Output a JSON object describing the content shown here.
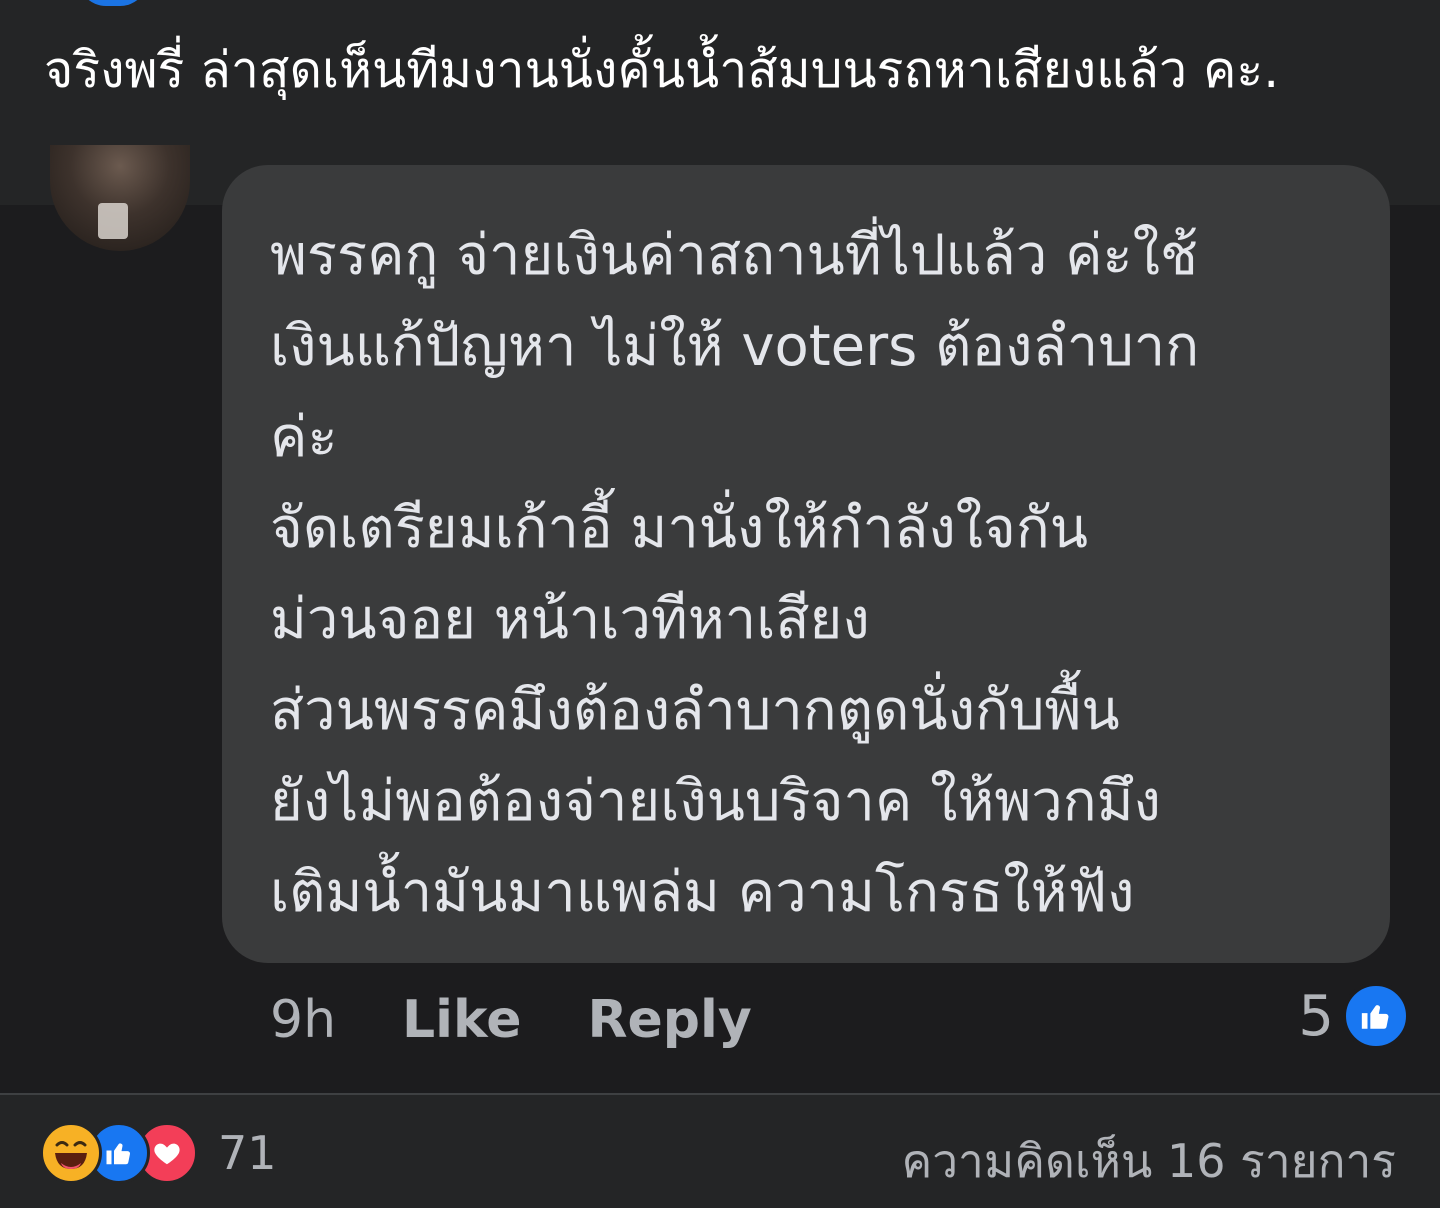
{
  "post": {
    "caption": "จริงพรี่ ล่าสุดเห็นทีมงานนั่งคั้นน้ำส้มบนรถหาเสียงแล้ว คะ."
  },
  "comment": {
    "lines": [
      "พรรคกู จ่ายเงินค่าสถานที่ไปแล้ว ค่ะใช้",
      "เงินแก้ปัญหา ไม่ให้ voters ต้องลำบาก",
      "ค่ะ",
      "จัดเตรียมเก้าอี้ มานั่งให้กำลังใจกัน",
      "ม่วนจอย หน้าเวทีหาเสียง",
      "ส่วนพรรคมึงต้องลำบากตูดนั่งกับพื้น",
      "ยังไม่พอต้องจ่ายเงินบริจาค ให้พวกมึง",
      "เติมน้ำมันมาแพล่ม ความโกรธให้ฟัง"
    ],
    "time": "9h",
    "like_label": "Like",
    "reply_label": "Reply",
    "reaction_count": "5",
    "reaction_icon": "like-icon"
  },
  "footer": {
    "reactions": [
      "haha-icon",
      "like-icon",
      "love-icon"
    ],
    "reaction_count": "71",
    "comment_count_label": "ความคิดเห็น 16 รายการ"
  },
  "colors": {
    "background": "#242526",
    "bubble": "#3a3b3c",
    "accent": "#1877f2",
    "love": "#f33e58",
    "haha": "#f7b125"
  }
}
